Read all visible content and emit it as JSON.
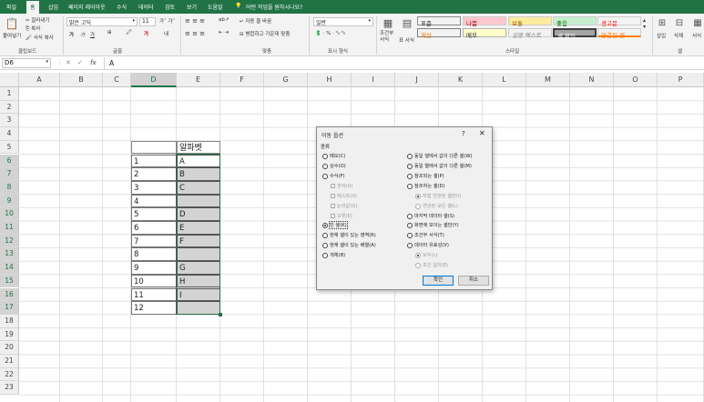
{
  "tabs": [
    "파일",
    "홈",
    "삽입",
    "페이지 레이아웃",
    "수식",
    "데이터",
    "검토",
    "보기",
    "도움말"
  ],
  "tell_me": "어떤 작업을 원하시나요?",
  "ribbon": {
    "paste": "붙여넣기",
    "cut": "잘라내기",
    "copy": "복사",
    "format_painter": "서식 복사",
    "font_name": "맑은 고딕",
    "font_size": "11",
    "wrap_text": "자동 줄 바꿈",
    "merge_center": "병합하고 가운데 맞춤",
    "number_format": "일반",
    "cond_format": "조건부 서식",
    "table_format": "표 서식",
    "insert": "삽입",
    "delete": "삭제",
    "format": "서식",
    "styles": [
      {
        "label": "표준",
        "bg": "#ffffff",
        "fg": "#000000"
      },
      {
        "label": "나쁨",
        "bg": "#ffc7ce",
        "fg": "#9c0006"
      },
      {
        "label": "보통",
        "bg": "#ffeb9c",
        "fg": "#9c5700"
      },
      {
        "label": "좋음",
        "bg": "#c6efce",
        "fg": "#006100"
      },
      {
        "label": "경고문",
        "bg": "#ffffff",
        "fg": "#ff0000"
      },
      {
        "label": "계산",
        "bg": "#f2f2f2",
        "fg": "#fa7d00"
      },
      {
        "label": "메모",
        "bg": "#ffffcc",
        "fg": "#000000"
      },
      {
        "label": "설명 텍스트",
        "bg": "#ffffff",
        "fg": "#7f7f7f"
      },
      {
        "label": "셀 확인",
        "bg": "#a5a5a5",
        "fg": "#ffffff"
      },
      {
        "label": "연결된 셀",
        "bg": "#ffffff",
        "fg": "#fa7d00"
      }
    ],
    "groups": [
      "클립보드",
      "글꼴",
      "맞춤",
      "표시 형식",
      "스타일",
      "셀"
    ]
  },
  "formula": {
    "name_box": "D6",
    "fx": "fx",
    "value": "A"
  },
  "columns": [
    "A",
    "B",
    "C",
    "D",
    "E",
    "F",
    "G",
    "H",
    "I",
    "J",
    "K",
    "L",
    "M",
    "N",
    "O",
    "P"
  ],
  "rows": [
    "1",
    "2",
    "3",
    "4",
    "5",
    "6",
    "7",
    "8",
    "9",
    "10",
    "11",
    "12",
    "13",
    "14",
    "15",
    "16",
    "17",
    "18",
    "19",
    "20",
    "21",
    "22",
    "23"
  ],
  "cells": {
    "D5": "알파벳",
    "C": [
      "1",
      "2",
      "3",
      "4",
      "5",
      "6",
      "7",
      "8",
      "9",
      "10",
      "11",
      "12"
    ],
    "D": [
      "A",
      "B",
      "C",
      "",
      "D",
      "E",
      "F",
      "",
      "G",
      "H",
      "I",
      ""
    ]
  },
  "dialog": {
    "title": "이동 옵션",
    "help": "?",
    "close": "✕",
    "section": "종류",
    "left": [
      {
        "label": "메모(C)",
        "type": "radio"
      },
      {
        "label": "상수(O)",
        "type": "radio"
      },
      {
        "label": "수식(F)",
        "type": "radio"
      },
      {
        "label": "숫자(U)",
        "type": "check",
        "disabled": true
      },
      {
        "label": "텍스트(X)",
        "type": "check",
        "disabled": true
      },
      {
        "label": "논리값(G)",
        "type": "check",
        "disabled": true
      },
      {
        "label": "오류(E)",
        "type": "check",
        "disabled": true
      },
      {
        "label": "빈 셀(K)",
        "type": "radio",
        "selected": true
      },
      {
        "label": "현재 셀이 있는 영역(R)",
        "type": "radio"
      },
      {
        "label": "현재 셀이 있는 배열(A)",
        "type": "radio"
      },
      {
        "label": "개체(B)",
        "type": "radio"
      }
    ],
    "right": [
      {
        "label": "동일 행에서 값이 다른 셀(W)",
        "type": "radio"
      },
      {
        "label": "동일 열에서 값이 다른 셀(M)",
        "type": "radio"
      },
      {
        "label": "참조되는 셀(P)",
        "type": "radio"
      },
      {
        "label": "참조하는 셀(D)",
        "type": "radio"
      },
      {
        "label": "직접 연관된 셀만(I)",
        "type": "radio",
        "disabled": true,
        "selected": true
      },
      {
        "label": "연관된 모든 셀(L)",
        "type": "radio",
        "disabled": true
      },
      {
        "label": "마지막 데이터 셀(S)",
        "type": "radio"
      },
      {
        "label": "화면에 보이는 셀만(Y)",
        "type": "radio"
      },
      {
        "label": "조건부 서식(T)",
        "type": "radio"
      },
      {
        "label": "데이터 유효성(V)",
        "type": "radio"
      },
      {
        "label": "모두(L)",
        "type": "radio",
        "disabled": true,
        "selected": true
      },
      {
        "label": "조건 일치(E)",
        "type": "radio",
        "disabled": true
      }
    ],
    "ok": "확인",
    "cancel": "취소"
  }
}
